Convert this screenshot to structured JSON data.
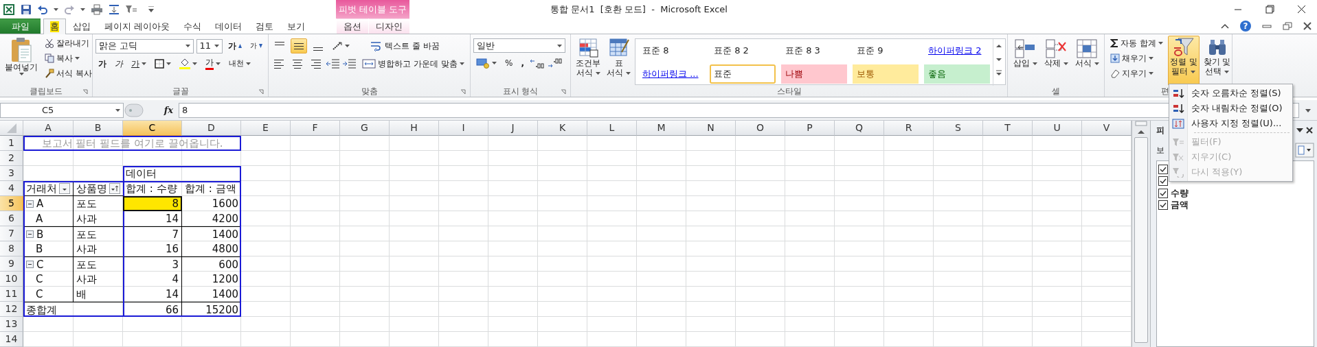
{
  "window": {
    "title": "통합 문서1  [호환 모드]  -  Microsoft Excel"
  },
  "context_group": {
    "label": "피벗 테이블 도구"
  },
  "tabs": [
    {
      "label": "파일",
      "kind": "file",
      "selected": false
    },
    {
      "label": "홈",
      "kind": "normal",
      "selected": true
    },
    {
      "label": "삽입",
      "kind": "normal",
      "selected": false
    },
    {
      "label": "페이지 레이아웃",
      "kind": "normal",
      "selected": false
    },
    {
      "label": "수식",
      "kind": "normal",
      "selected": false
    },
    {
      "label": "데이터",
      "kind": "normal",
      "selected": false
    },
    {
      "label": "검토",
      "kind": "normal",
      "selected": false
    },
    {
      "label": "보기",
      "kind": "normal",
      "selected": false
    },
    {
      "label": "옵션",
      "kind": "context",
      "selected": false
    },
    {
      "label": "디자인",
      "kind": "context",
      "selected": false
    }
  ],
  "help": {
    "glyph": "?"
  },
  "clipboard": {
    "label": "클립보드",
    "paste": "붙여넣기",
    "cut": "잘라내기",
    "copy": "복사",
    "format_painter": "서식 복사"
  },
  "font": {
    "label": "글꼴",
    "name": "맑은 고딕",
    "size": "11",
    "grow": "가",
    "shrink": "가",
    "bold": "가",
    "italic": "가",
    "underline": "가",
    "font_color": "가",
    "phonetic": "내천"
  },
  "alignment": {
    "label": "맞춤",
    "buttons": [
      {
        "kind": "top",
        "selected": false
      },
      {
        "kind": "middle",
        "selected": true
      },
      {
        "kind": "bottom",
        "selected": false
      },
      {
        "kind": "left",
        "selected": false
      },
      {
        "kind": "center",
        "selected": false
      },
      {
        "kind": "right",
        "selected": false
      }
    ],
    "wrap": "텍스트 줄 바꿈",
    "merge": "병합하고 가운데 맞춤"
  },
  "number": {
    "label": "표시 형식",
    "format": "일반",
    "percent": "%",
    "comma": ","
  },
  "styles": {
    "label": "스타일",
    "conditional": [
      "조건부",
      "서식"
    ],
    "table": [
      "표",
      "서식"
    ],
    "gallery": [
      {
        "label": "표준 8",
        "kind": "plain",
        "selected": false
      },
      {
        "label": "표준 8 2",
        "kind": "plain",
        "selected": false
      },
      {
        "label": "표준 8 3",
        "kind": "plain",
        "selected": false
      },
      {
        "label": "표준 9",
        "kind": "plain",
        "selected": false
      },
      {
        "label": "하이퍼링크 2",
        "kind": "link",
        "selected": false
      },
      {
        "label": "하이퍼링크 ...",
        "kind": "link",
        "selected": false
      },
      {
        "label": "표준",
        "kind": "normal",
        "selected": true
      },
      {
        "label": "나쁨",
        "kind": "bad",
        "selected": false
      },
      {
        "label": "보통",
        "kind": "neutral",
        "selected": false
      },
      {
        "label": "좋음",
        "kind": "good",
        "selected": false
      }
    ]
  },
  "cells": {
    "label": "셀",
    "insert": "삽입",
    "delete": "삭제",
    "format": "서식"
  },
  "editing": {
    "label": "편",
    "autosum": "자동 합계",
    "fill": "채우기",
    "clear": "지우기",
    "sort_filter": {
      "lines": [
        "정렬 및",
        "필터"
      ],
      "pressed": true
    },
    "find": [
      "찾기 및",
      "선택"
    ]
  },
  "sort_menu": {
    "items": [
      {
        "kind": "asc",
        "label": "숫자 오름차순 정렬(S)",
        "disabled": false
      },
      {
        "kind": "desc",
        "label": "숫자 내림차순 정렬(O)",
        "disabled": false
      },
      {
        "kind": "custom",
        "label": "사용자 지정 정렬(U)...",
        "disabled": false
      },
      {
        "kind": "separator"
      },
      {
        "kind": "filter",
        "label": "필터(F)",
        "disabled": true
      },
      {
        "kind": "clear",
        "label": "지우기(C)",
        "disabled": true
      },
      {
        "kind": "reapply",
        "label": "다시 적용(Y)",
        "disabled": true
      }
    ]
  },
  "formula_bar": {
    "name_box": "C5",
    "fx": "fx",
    "value": "8"
  },
  "sheet": {
    "columns": [
      {
        "label": "A",
        "selected": false
      },
      {
        "label": "B",
        "selected": false
      },
      {
        "label": "C",
        "selected": true
      },
      {
        "label": "D",
        "selected": false
      },
      {
        "label": "E",
        "selected": false
      },
      {
        "label": "F",
        "selected": false
      },
      {
        "label": "G",
        "selected": false
      },
      {
        "label": "H",
        "selected": false
      },
      {
        "label": "I",
        "selected": false
      },
      {
        "label": "J",
        "selected": false
      },
      {
        "label": "K",
        "selected": false
      },
      {
        "label": "L",
        "selected": false
      },
      {
        "label": "M",
        "selected": false
      },
      {
        "label": "N",
        "selected": false
      },
      {
        "label": "O",
        "selected": false
      },
      {
        "label": "P",
        "selected": false
      },
      {
        "label": "Q",
        "selected": false
      },
      {
        "label": "R",
        "selected": false
      },
      {
        "label": "S",
        "selected": false
      },
      {
        "label": "T",
        "selected": false
      },
      {
        "label": "U",
        "selected": false
      },
      {
        "label": "V",
        "selected": false
      }
    ],
    "rows": [
      {
        "label": "1",
        "selected": false
      },
      {
        "label": "2",
        "selected": false
      },
      {
        "label": "3",
        "selected": false
      },
      {
        "label": "4",
        "selected": false
      },
      {
        "label": "5",
        "selected": true
      },
      {
        "label": "6",
        "selected": false
      },
      {
        "label": "7",
        "selected": false
      },
      {
        "label": "8",
        "selected": false
      },
      {
        "label": "9",
        "selected": false
      },
      {
        "label": "10",
        "selected": false
      },
      {
        "label": "11",
        "selected": false
      },
      {
        "label": "12",
        "selected": false
      },
      {
        "label": "13",
        "selected": false
      },
      {
        "label": "14",
        "selected": false
      }
    ]
  },
  "pivot": {
    "filter_hint": "보고서 필터 필드를 여기로 끌어옵니다.",
    "data_caption": "데이터",
    "row_fields": [
      {
        "label": "거래처",
        "kind": "dropdown"
      },
      {
        "label": "상품명",
        "kind": "sort"
      }
    ],
    "value_fields": [
      "합계 : 수량",
      "합계 : 금액"
    ],
    "rows": [
      {
        "group": "A",
        "expander": true,
        "item": "포도",
        "values": [
          {
            "text": "8",
            "selected": true
          },
          {
            "text": "1600",
            "selected": false
          }
        ]
      },
      {
        "group": "A",
        "expander": false,
        "item": "사과",
        "values": [
          {
            "text": "14",
            "selected": false
          },
          {
            "text": "4200",
            "selected": false
          }
        ]
      },
      {
        "group": "B",
        "expander": true,
        "item": "포도",
        "values": [
          {
            "text": "7",
            "selected": false
          },
          {
            "text": "1400",
            "selected": false
          }
        ]
      },
      {
        "group": "B",
        "expander": false,
        "item": "사과",
        "values": [
          {
            "text": "16",
            "selected": false
          },
          {
            "text": "4800",
            "selected": false
          }
        ]
      },
      {
        "group": "C",
        "expander": true,
        "item": "포도",
        "values": [
          {
            "text": "3",
            "selected": false
          },
          {
            "text": "600",
            "selected": false
          }
        ]
      },
      {
        "group": "C",
        "expander": false,
        "item": "사과",
        "values": [
          {
            "text": "4",
            "selected": false
          },
          {
            "text": "1200",
            "selected": false
          }
        ]
      },
      {
        "group": "C",
        "expander": false,
        "item": "배",
        "values": [
          {
            "text": "14",
            "selected": false
          },
          {
            "text": "1400",
            "selected": false
          }
        ]
      }
    ],
    "total": {
      "label": "종합계",
      "values": [
        "66",
        "15200"
      ]
    }
  },
  "field_pane": {
    "title": "피",
    "section": "보",
    "fields": [
      {
        "checked": true
      },
      {
        "checked": true
      },
      {
        "label": "수량",
        "checked": true
      },
      {
        "label": "금액",
        "checked": true
      }
    ]
  }
}
